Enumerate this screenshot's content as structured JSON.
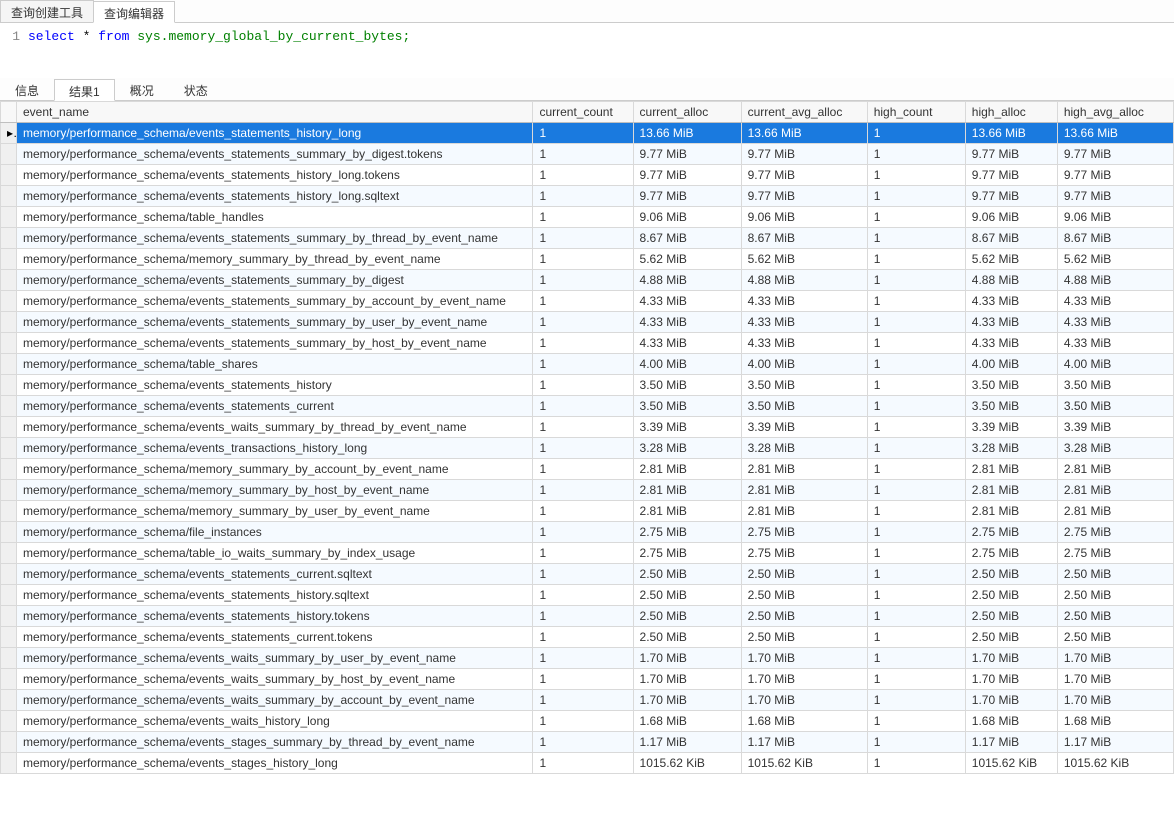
{
  "top_tabs": [
    {
      "label": "查询创建工具",
      "active": false
    },
    {
      "label": "查询编辑器",
      "active": true
    }
  ],
  "editor": {
    "line_number": "1",
    "tokens": [
      {
        "t": "select",
        "c": "kw-blue"
      },
      {
        "t": " * ",
        "c": "kw-black"
      },
      {
        "t": "from",
        "c": "kw-blue"
      },
      {
        "t": " sys.memory_global_by_current_bytes;",
        "c": "kw-green"
      }
    ]
  },
  "result_tabs": [
    {
      "label": "信息",
      "active": false
    },
    {
      "label": "结果1",
      "active": true
    },
    {
      "label": "概况",
      "active": false
    },
    {
      "label": "状态",
      "active": false
    }
  ],
  "columns": [
    "event_name",
    "current_count",
    "current_alloc",
    "current_avg_alloc",
    "high_count",
    "high_alloc",
    "high_avg_alloc"
  ],
  "row_marker": "▸",
  "rows": [
    {
      "sel": true,
      "event_name": "memory/performance_schema/events_statements_history_long",
      "current_count": "1",
      "current_alloc": "13.66 MiB",
      "current_avg_alloc": "13.66 MiB",
      "high_count": "1",
      "high_alloc": "13.66 MiB",
      "high_avg_alloc": "13.66 MiB"
    },
    {
      "event_name": "memory/performance_schema/events_statements_summary_by_digest.tokens",
      "current_count": "1",
      "current_alloc": "9.77 MiB",
      "current_avg_alloc": "9.77 MiB",
      "high_count": "1",
      "high_alloc": "9.77 MiB",
      "high_avg_alloc": "9.77 MiB"
    },
    {
      "event_name": "memory/performance_schema/events_statements_history_long.tokens",
      "current_count": "1",
      "current_alloc": "9.77 MiB",
      "current_avg_alloc": "9.77 MiB",
      "high_count": "1",
      "high_alloc": "9.77 MiB",
      "high_avg_alloc": "9.77 MiB"
    },
    {
      "event_name": "memory/performance_schema/events_statements_history_long.sqltext",
      "current_count": "1",
      "current_alloc": "9.77 MiB",
      "current_avg_alloc": "9.77 MiB",
      "high_count": "1",
      "high_alloc": "9.77 MiB",
      "high_avg_alloc": "9.77 MiB"
    },
    {
      "event_name": "memory/performance_schema/table_handles",
      "current_count": "1",
      "current_alloc": "9.06 MiB",
      "current_avg_alloc": "9.06 MiB",
      "high_count": "1",
      "high_alloc": "9.06 MiB",
      "high_avg_alloc": "9.06 MiB"
    },
    {
      "event_name": "memory/performance_schema/events_statements_summary_by_thread_by_event_name",
      "current_count": "1",
      "current_alloc": "8.67 MiB",
      "current_avg_alloc": "8.67 MiB",
      "high_count": "1",
      "high_alloc": "8.67 MiB",
      "high_avg_alloc": "8.67 MiB"
    },
    {
      "event_name": "memory/performance_schema/memory_summary_by_thread_by_event_name",
      "current_count": "1",
      "current_alloc": "5.62 MiB",
      "current_avg_alloc": "5.62 MiB",
      "high_count": "1",
      "high_alloc": "5.62 MiB",
      "high_avg_alloc": "5.62 MiB"
    },
    {
      "event_name": "memory/performance_schema/events_statements_summary_by_digest",
      "current_count": "1",
      "current_alloc": "4.88 MiB",
      "current_avg_alloc": "4.88 MiB",
      "high_count": "1",
      "high_alloc": "4.88 MiB",
      "high_avg_alloc": "4.88 MiB"
    },
    {
      "event_name": "memory/performance_schema/events_statements_summary_by_account_by_event_name",
      "current_count": "1",
      "current_alloc": "4.33 MiB",
      "current_avg_alloc": "4.33 MiB",
      "high_count": "1",
      "high_alloc": "4.33 MiB",
      "high_avg_alloc": "4.33 MiB"
    },
    {
      "event_name": "memory/performance_schema/events_statements_summary_by_user_by_event_name",
      "current_count": "1",
      "current_alloc": "4.33 MiB",
      "current_avg_alloc": "4.33 MiB",
      "high_count": "1",
      "high_alloc": "4.33 MiB",
      "high_avg_alloc": "4.33 MiB"
    },
    {
      "event_name": "memory/performance_schema/events_statements_summary_by_host_by_event_name",
      "current_count": "1",
      "current_alloc": "4.33 MiB",
      "current_avg_alloc": "4.33 MiB",
      "high_count": "1",
      "high_alloc": "4.33 MiB",
      "high_avg_alloc": "4.33 MiB"
    },
    {
      "event_name": "memory/performance_schema/table_shares",
      "current_count": "1",
      "current_alloc": "4.00 MiB",
      "current_avg_alloc": "4.00 MiB",
      "high_count": "1",
      "high_alloc": "4.00 MiB",
      "high_avg_alloc": "4.00 MiB"
    },
    {
      "event_name": "memory/performance_schema/events_statements_history",
      "current_count": "1",
      "current_alloc": "3.50 MiB",
      "current_avg_alloc": "3.50 MiB",
      "high_count": "1",
      "high_alloc": "3.50 MiB",
      "high_avg_alloc": "3.50 MiB"
    },
    {
      "event_name": "memory/performance_schema/events_statements_current",
      "current_count": "1",
      "current_alloc": "3.50 MiB",
      "current_avg_alloc": "3.50 MiB",
      "high_count": "1",
      "high_alloc": "3.50 MiB",
      "high_avg_alloc": "3.50 MiB"
    },
    {
      "event_name": "memory/performance_schema/events_waits_summary_by_thread_by_event_name",
      "current_count": "1",
      "current_alloc": "3.39 MiB",
      "current_avg_alloc": "3.39 MiB",
      "high_count": "1",
      "high_alloc": "3.39 MiB",
      "high_avg_alloc": "3.39 MiB"
    },
    {
      "event_name": "memory/performance_schema/events_transactions_history_long",
      "current_count": "1",
      "current_alloc": "3.28 MiB",
      "current_avg_alloc": "3.28 MiB",
      "high_count": "1",
      "high_alloc": "3.28 MiB",
      "high_avg_alloc": "3.28 MiB"
    },
    {
      "event_name": "memory/performance_schema/memory_summary_by_account_by_event_name",
      "current_count": "1",
      "current_alloc": "2.81 MiB",
      "current_avg_alloc": "2.81 MiB",
      "high_count": "1",
      "high_alloc": "2.81 MiB",
      "high_avg_alloc": "2.81 MiB"
    },
    {
      "event_name": "memory/performance_schema/memory_summary_by_host_by_event_name",
      "current_count": "1",
      "current_alloc": "2.81 MiB",
      "current_avg_alloc": "2.81 MiB",
      "high_count": "1",
      "high_alloc": "2.81 MiB",
      "high_avg_alloc": "2.81 MiB"
    },
    {
      "event_name": "memory/performance_schema/memory_summary_by_user_by_event_name",
      "current_count": "1",
      "current_alloc": "2.81 MiB",
      "current_avg_alloc": "2.81 MiB",
      "high_count": "1",
      "high_alloc": "2.81 MiB",
      "high_avg_alloc": "2.81 MiB"
    },
    {
      "event_name": "memory/performance_schema/file_instances",
      "current_count": "1",
      "current_alloc": "2.75 MiB",
      "current_avg_alloc": "2.75 MiB",
      "high_count": "1",
      "high_alloc": "2.75 MiB",
      "high_avg_alloc": "2.75 MiB"
    },
    {
      "event_name": "memory/performance_schema/table_io_waits_summary_by_index_usage",
      "current_count": "1",
      "current_alloc": "2.75 MiB",
      "current_avg_alloc": "2.75 MiB",
      "high_count": "1",
      "high_alloc": "2.75 MiB",
      "high_avg_alloc": "2.75 MiB"
    },
    {
      "event_name": "memory/performance_schema/events_statements_current.sqltext",
      "current_count": "1",
      "current_alloc": "2.50 MiB",
      "current_avg_alloc": "2.50 MiB",
      "high_count": "1",
      "high_alloc": "2.50 MiB",
      "high_avg_alloc": "2.50 MiB"
    },
    {
      "event_name": "memory/performance_schema/events_statements_history.sqltext",
      "current_count": "1",
      "current_alloc": "2.50 MiB",
      "current_avg_alloc": "2.50 MiB",
      "high_count": "1",
      "high_alloc": "2.50 MiB",
      "high_avg_alloc": "2.50 MiB"
    },
    {
      "event_name": "memory/performance_schema/events_statements_history.tokens",
      "current_count": "1",
      "current_alloc": "2.50 MiB",
      "current_avg_alloc": "2.50 MiB",
      "high_count": "1",
      "high_alloc": "2.50 MiB",
      "high_avg_alloc": "2.50 MiB"
    },
    {
      "event_name": "memory/performance_schema/events_statements_current.tokens",
      "current_count": "1",
      "current_alloc": "2.50 MiB",
      "current_avg_alloc": "2.50 MiB",
      "high_count": "1",
      "high_alloc": "2.50 MiB",
      "high_avg_alloc": "2.50 MiB"
    },
    {
      "event_name": "memory/performance_schema/events_waits_summary_by_user_by_event_name",
      "current_count": "1",
      "current_alloc": "1.70 MiB",
      "current_avg_alloc": "1.70 MiB",
      "high_count": "1",
      "high_alloc": "1.70 MiB",
      "high_avg_alloc": "1.70 MiB"
    },
    {
      "event_name": "memory/performance_schema/events_waits_summary_by_host_by_event_name",
      "current_count": "1",
      "current_alloc": "1.70 MiB",
      "current_avg_alloc": "1.70 MiB",
      "high_count": "1",
      "high_alloc": "1.70 MiB",
      "high_avg_alloc": "1.70 MiB"
    },
    {
      "event_name": "memory/performance_schema/events_waits_summary_by_account_by_event_name",
      "current_count": "1",
      "current_alloc": "1.70 MiB",
      "current_avg_alloc": "1.70 MiB",
      "high_count": "1",
      "high_alloc": "1.70 MiB",
      "high_avg_alloc": "1.70 MiB"
    },
    {
      "event_name": "memory/performance_schema/events_waits_history_long",
      "current_count": "1",
      "current_alloc": "1.68 MiB",
      "current_avg_alloc": "1.68 MiB",
      "high_count": "1",
      "high_alloc": "1.68 MiB",
      "high_avg_alloc": "1.68 MiB"
    },
    {
      "event_name": "memory/performance_schema/events_stages_summary_by_thread_by_event_name",
      "current_count": "1",
      "current_alloc": "1.17 MiB",
      "current_avg_alloc": "1.17 MiB",
      "high_count": "1",
      "high_alloc": "1.17 MiB",
      "high_avg_alloc": "1.17 MiB"
    },
    {
      "event_name": "memory/performance_schema/events_stages_history_long",
      "current_count": "1",
      "current_alloc": "1015.62 KiB",
      "current_avg_alloc": "1015.62 KiB",
      "high_count": "1",
      "high_alloc": "1015.62 KiB",
      "high_avg_alloc": "1015.62 KiB"
    }
  ]
}
